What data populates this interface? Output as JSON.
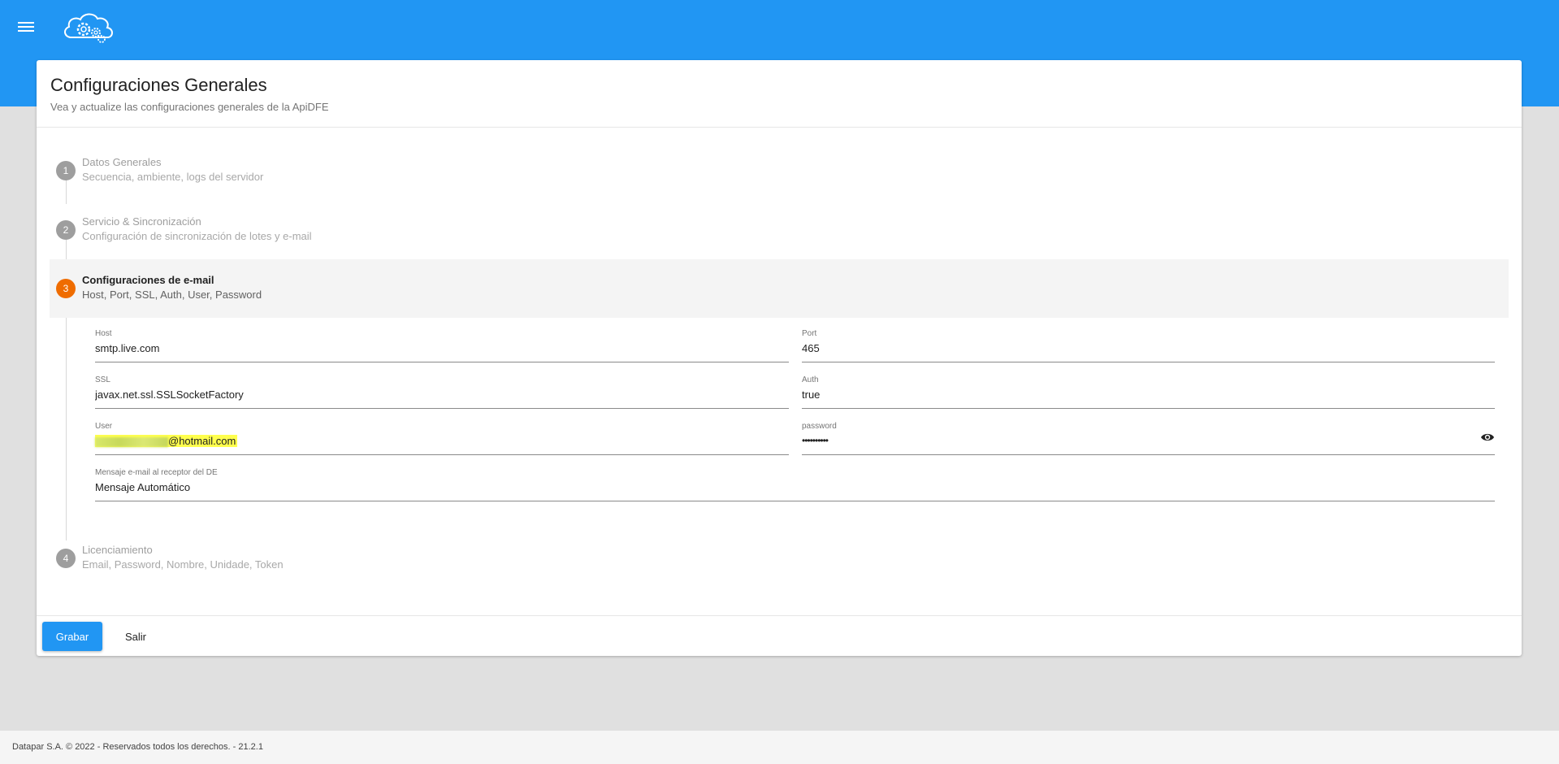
{
  "header": {
    "menu_icon": "menu-icon",
    "logo_icon": "cloud-gears-logo",
    "color": "#2196f3"
  },
  "card": {
    "title": "Configuraciones Generales",
    "subtitle": "Vea y actualize las configuraciones generales de la ApiDFE"
  },
  "steps": [
    {
      "number": "1",
      "title": "Datos Generales",
      "subtitle": "Secuencia, ambiente, logs del servidor",
      "state": "inactive"
    },
    {
      "number": "2",
      "title": "Servicio & Sincronización",
      "subtitle": "Configuración de sincronización de lotes y e-mail",
      "state": "inactive"
    },
    {
      "number": "3",
      "title": "Configuraciones de e-mail",
      "subtitle": "Host, Port, SSL, Auth, User, Password",
      "state": "active",
      "active_color": "#ef6c00"
    },
    {
      "number": "4",
      "title": "Licenciamiento",
      "subtitle": "Email, Password, Nombre, Unidade, Token",
      "state": "inactive"
    }
  ],
  "email_form": {
    "host": {
      "label": "Host",
      "value": "smtp.live.com"
    },
    "port": {
      "label": "Port",
      "value": "465"
    },
    "ssl": {
      "label": "SSL",
      "value": "javax.net.ssl.SSLSocketFactory"
    },
    "auth": {
      "label": "Auth",
      "value": "true"
    },
    "user": {
      "label": "User",
      "value": "@hotmail.com",
      "highlight_color": "#ffff4d"
    },
    "password": {
      "label": "password",
      "value": "••••••••••",
      "toggle_icon": "eye-icon"
    },
    "mensaje": {
      "label": "Mensaje e-mail al receptor del DE",
      "value": "Mensaje Automático"
    }
  },
  "actions": {
    "save_label": "Grabar",
    "exit_label": "Salir"
  },
  "footer": {
    "text": "Datapar S.A. © 2022 - Reservados todos los derechos. - 21.2.1"
  }
}
